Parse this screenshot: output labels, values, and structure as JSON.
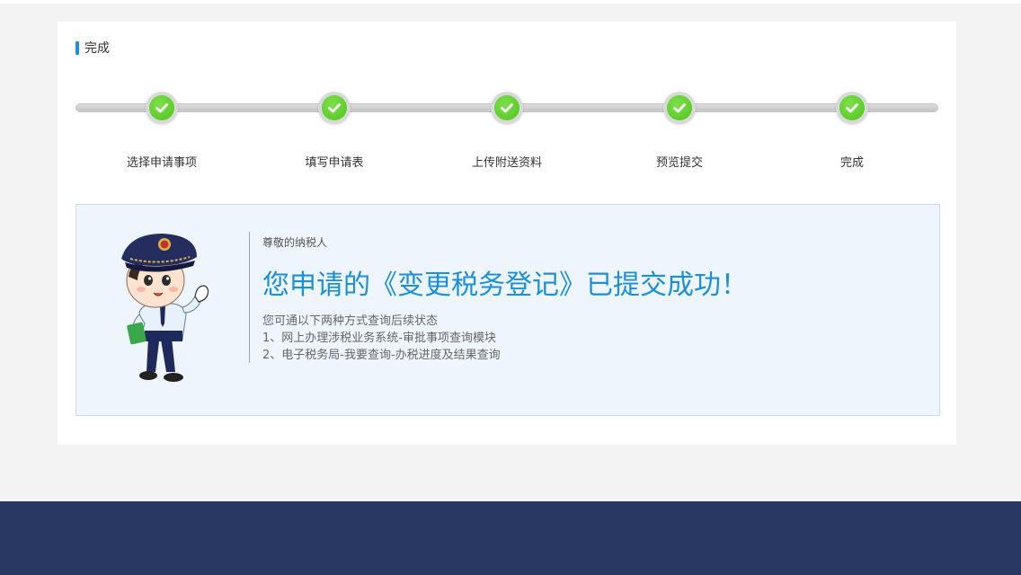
{
  "section": {
    "title": "完成"
  },
  "steps": [
    {
      "label": "选择申请事项",
      "status": "done"
    },
    {
      "label": "填写申请表",
      "status": "done"
    },
    {
      "label": "上传附送资料",
      "status": "done"
    },
    {
      "label": "预览提交",
      "status": "done"
    },
    {
      "label": "完成",
      "status": "done"
    }
  ],
  "result": {
    "greeting": "尊敬的纳税人",
    "headline": "您申请的《变更税务登记》已提交成功！",
    "tips_intro": "您可通以下两种方式查询后续状态",
    "tips": [
      "1、网上办理涉税业务系统-审批事项查询模块",
      "2、电子税务局-我要查询-办税进度及结果查询"
    ]
  },
  "colors": {
    "accent": "#1e8fe0",
    "headline": "#1a8fdc",
    "success": "#55c624",
    "footer": "#283862"
  },
  "icons": {
    "step": "check-circle-icon",
    "mascot": "tax-officer-mascot"
  }
}
